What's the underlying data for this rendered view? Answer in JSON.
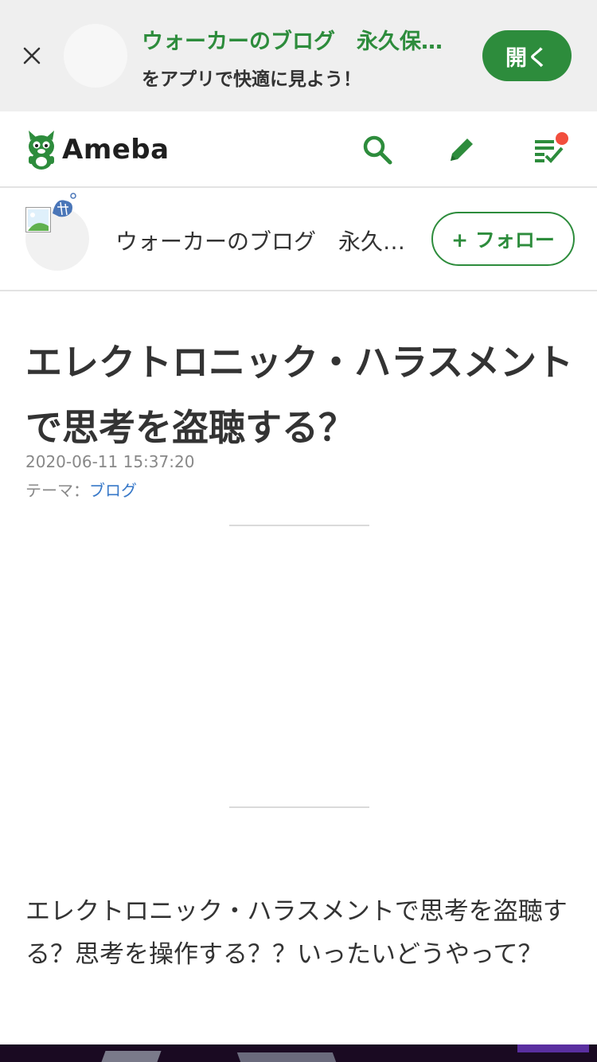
{
  "app_banner": {
    "title": "ウォーカーのブログ　永久保…",
    "subtitle": "をアプリで快適に見よう！",
    "open_label": "開く"
  },
  "header": {
    "logo_text": "Ameba",
    "icons": [
      "search-icon",
      "pencil-icon",
      "checklist-icon"
    ],
    "accent_color": "#2d8c3c",
    "notification_color": "#f24e3d"
  },
  "blog": {
    "name": "ウォーカーのブログ　永久…",
    "follow_label": "+ フォロー"
  },
  "article": {
    "title": "エレクトロニック・ハラスメントで思考を盗聴する？",
    "date": "2020-06-11 15:37:20",
    "theme_label": "テーマ：",
    "theme_link": "ブログ",
    "body": "エレクトロニック・ハラスメントで思考を盗聴する？思考を操作する？？いったいどうやって？"
  }
}
